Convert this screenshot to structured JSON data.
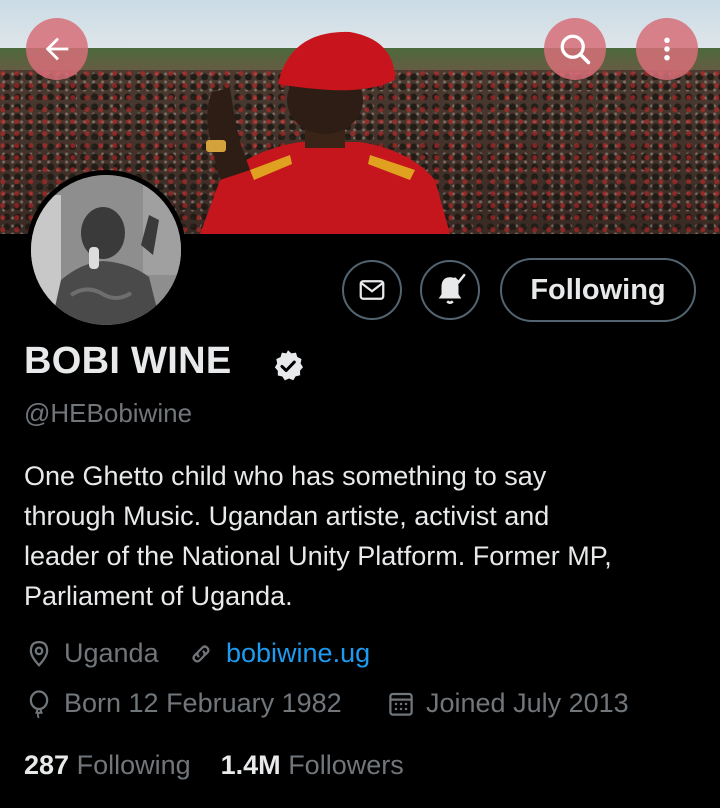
{
  "header": {
    "back_icon": "arrow-left-icon",
    "search_icon": "search-icon",
    "more_icon": "more-vertical-icon",
    "accent_button_color": "#d66e78"
  },
  "actions": {
    "message_icon": "envelope-icon",
    "notify_icon": "bell-check-icon",
    "follow_label": "Following"
  },
  "profile": {
    "name": "BOBI WINE",
    "verified_icon": "verified-badge-icon",
    "handle": "@HEBobiwine",
    "bio_lines": [
      "One Ghetto child who has something to say",
      "through Music. Ugandan artiste, activist and",
      "leader of the National Unity Platform. Former MP,",
      "Parliament of Uganda."
    ],
    "location": "Uganda",
    "website": "bobiwine.ug",
    "born": "Born 12 February 1982",
    "joined": "Joined July 2013"
  },
  "stats": {
    "following_count": "287",
    "following_label": "Following",
    "followers_count": "1.4M",
    "followers_label": "Followers"
  },
  "colors": {
    "background": "#000000",
    "text_primary": "#e7e9ea",
    "text_secondary": "#71767b",
    "link": "#1d9bf0",
    "border": "#536471"
  }
}
